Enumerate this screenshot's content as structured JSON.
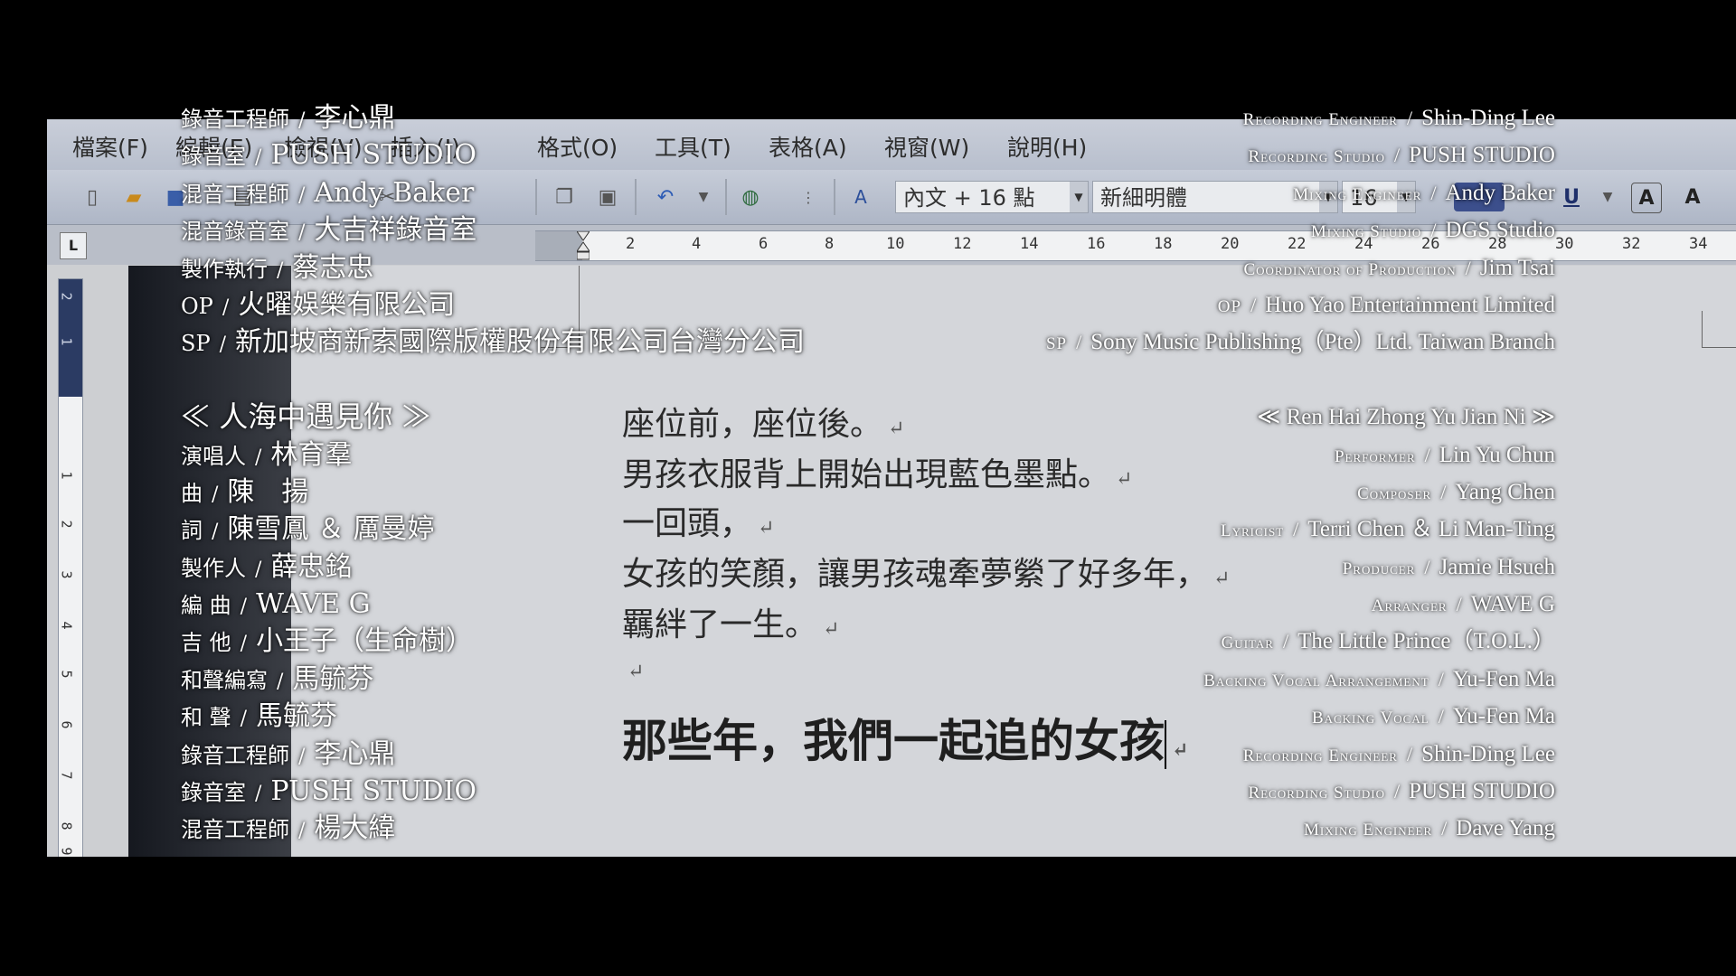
{
  "menu": {
    "items": [
      "檔案(F)",
      "編輯(E)",
      "檢視(V)",
      "插入(I)",
      "格式(O)",
      "工具(T)",
      "表格(A)",
      "視窗(W)",
      "說明(H)"
    ]
  },
  "toolbar": {
    "style_combo": "內文 + 16 點",
    "font_combo": "新細明體",
    "size_combo": "16"
  },
  "ruler": {
    "ticks": [
      "2",
      "4",
      "6",
      "8",
      "10",
      "12",
      "14",
      "16",
      "18",
      "20",
      "22",
      "24",
      "26",
      "28",
      "30",
      "32",
      "34"
    ],
    "tab_marker": "L",
    "vticks": [
      "2",
      "1",
      "1",
      "2",
      "3",
      "4",
      "5",
      "6",
      "7",
      "8",
      "9"
    ]
  },
  "document": {
    "lines": [
      "座位前，座位後。",
      "男孩衣服背上開始出現藍色墨點。",
      "一回頭，",
      "女孩的笑顏，讓男孩魂牽夢縈了好多年，",
      "羈絆了一生。",
      ""
    ],
    "title": "那些年，我們一起追的女孩"
  },
  "credits_left": [
    {
      "role": "錄音工程師",
      "name": "李心鼎"
    },
    {
      "role": "錄音室",
      "name": "PUSH STUDIO"
    },
    {
      "role": "混音工程師",
      "name": "Andy Baker"
    },
    {
      "role": "混音錄音室",
      "name": "大吉祥錄音室"
    },
    {
      "role": "製作執行",
      "name": "蔡志忠"
    },
    {
      "role": "OP",
      "name": "火曜娛樂有限公司"
    },
    {
      "role": "SP",
      "name": "新加坡商新索國際版權股份有限公司台灣分公司"
    },
    {
      "role": "",
      "name": ""
    },
    {
      "role": "",
      "name": "人海中遇見你"
    },
    {
      "role": "演唱人",
      "name": "林育羣"
    },
    {
      "role": "曲",
      "name": "陳　揚"
    },
    {
      "role": "詞",
      "name": "陳雪鳳 ＆ 厲曼婷"
    },
    {
      "role": "製作人",
      "name": "薛忠銘"
    },
    {
      "role": "編 曲",
      "name": "WAVE G"
    },
    {
      "role": "吉 他",
      "name": "小王子（生命樹）"
    },
    {
      "role": "和聲編寫",
      "name": "馬毓芬"
    },
    {
      "role": "和 聲",
      "name": "馬毓芬"
    },
    {
      "role": "錄音工程師",
      "name": "李心鼎"
    },
    {
      "role": "錄音室",
      "name": "PUSH STUDIO"
    },
    {
      "role": "混音工程師",
      "name": "楊大緯"
    }
  ],
  "credits_right": [
    {
      "role": "Recording Engineer",
      "name": "Shin-Ding Lee"
    },
    {
      "role": "Recording Studio",
      "name": "PUSH STUDIO"
    },
    {
      "role": "Mixing Engineer",
      "name": "Andy Baker"
    },
    {
      "role": "Mixing Studio",
      "name": "DGS Studio"
    },
    {
      "role": "Coordinator of Production",
      "name": "Jim Tsai"
    },
    {
      "role": "OP",
      "name": "Huo Yao Entertainment Limited"
    },
    {
      "role": "SP",
      "name": "Sony Music Publishing（Pte）Ltd. Taiwan Branch"
    },
    {
      "role": "",
      "name": ""
    },
    {
      "role": "",
      "name": "Ren Hai Zhong Yu Jian Ni"
    },
    {
      "role": "Performer",
      "name": "Lin Yu Chun"
    },
    {
      "role": "Composer",
      "name": "Yang Chen"
    },
    {
      "role": "Lyricist",
      "name": "Terri Chen ＆ Li Man-Ting"
    },
    {
      "role": "Producer",
      "name": "Jamie Hsueh"
    },
    {
      "role": "Arranger",
      "name": "WAVE G"
    },
    {
      "role": "Guitar",
      "name": "The Little Prince（T.O.L.）"
    },
    {
      "role": "Backing Vocal Arrangement",
      "name": "Yu-Fen Ma"
    },
    {
      "role": "Backing Vocal",
      "name": "Yu-Fen Ma"
    },
    {
      "role": "Recording Engineer",
      "name": "Shin-Ding Lee"
    },
    {
      "role": "Recording Studio",
      "name": "PUSH STUDIO"
    },
    {
      "role": "Mixing Engineer",
      "name": "Dave Yang"
    }
  ],
  "colors": {
    "letterbox": "#000000",
    "credit_text": "#ffffff",
    "page": "#d4d6da"
  }
}
